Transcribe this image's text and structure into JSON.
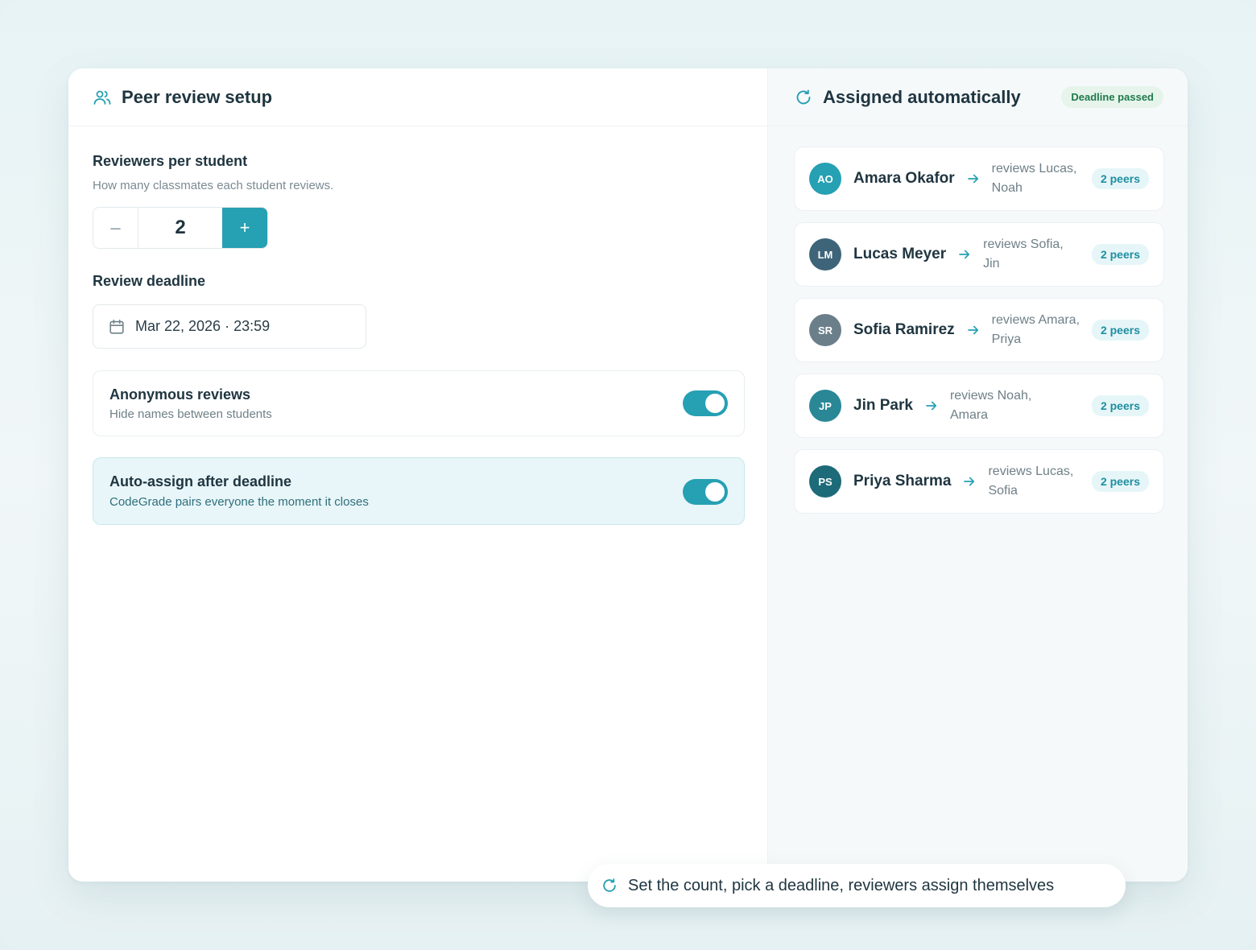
{
  "colors": {
    "accent": "#26a0b3",
    "badge_green_text": "#1f7a4a",
    "badge_green_bg": "#e6f4ec",
    "highlight_bg": "#e8f6f9"
  },
  "setup": {
    "title": "Peer review setup",
    "title_icon": "users-icon",
    "reviewers": {
      "label": "Reviewers per student",
      "hint": "How many classmates each student reviews.",
      "minus_label": "–",
      "value": "2",
      "plus_label": "+"
    },
    "deadline": {
      "label": "Review deadline",
      "icon": "calendar-icon",
      "value": "Mar 22, 2026 · 23:59"
    },
    "options": [
      {
        "title": "Anonymous reviews",
        "subtitle": "Hide names between students",
        "enabled": true
      },
      {
        "title": "Auto-assign after deadline",
        "subtitle": "CodeGrade pairs everyone the moment it closes",
        "enabled": true
      }
    ]
  },
  "assigned": {
    "title": "Assigned automatically",
    "title_icon": "refresh-icon",
    "badge": "Deadline passed",
    "items": [
      {
        "initials": "AO",
        "name": "Amara Okafor",
        "reviews": "reviews Lucas, Noah",
        "peers": "2 peers",
        "avatar_color": "#26a0b3"
      },
      {
        "initials": "LM",
        "name": "Lucas Meyer",
        "reviews": "reviews Sofia, Jin",
        "peers": "2 peers",
        "avatar_color": "#3d6478"
      },
      {
        "initials": "SR",
        "name": "Sofia Ramirez",
        "reviews": "reviews Amara, Priya",
        "peers": "2 peers",
        "avatar_color": "#6b7f8a"
      },
      {
        "initials": "JP",
        "name": "Jin Park",
        "reviews": "reviews Noah, Amara",
        "peers": "2 peers",
        "avatar_color": "#2a8796"
      },
      {
        "initials": "PS",
        "name": "Priya Sharma",
        "reviews": "reviews Lucas, Sofia",
        "peers": "2 peers",
        "avatar_color": "#1d6a78"
      }
    ]
  },
  "footer": {
    "icon": "refresh-icon",
    "text": "Set the count, pick a deadline, reviewers assign themselves"
  }
}
